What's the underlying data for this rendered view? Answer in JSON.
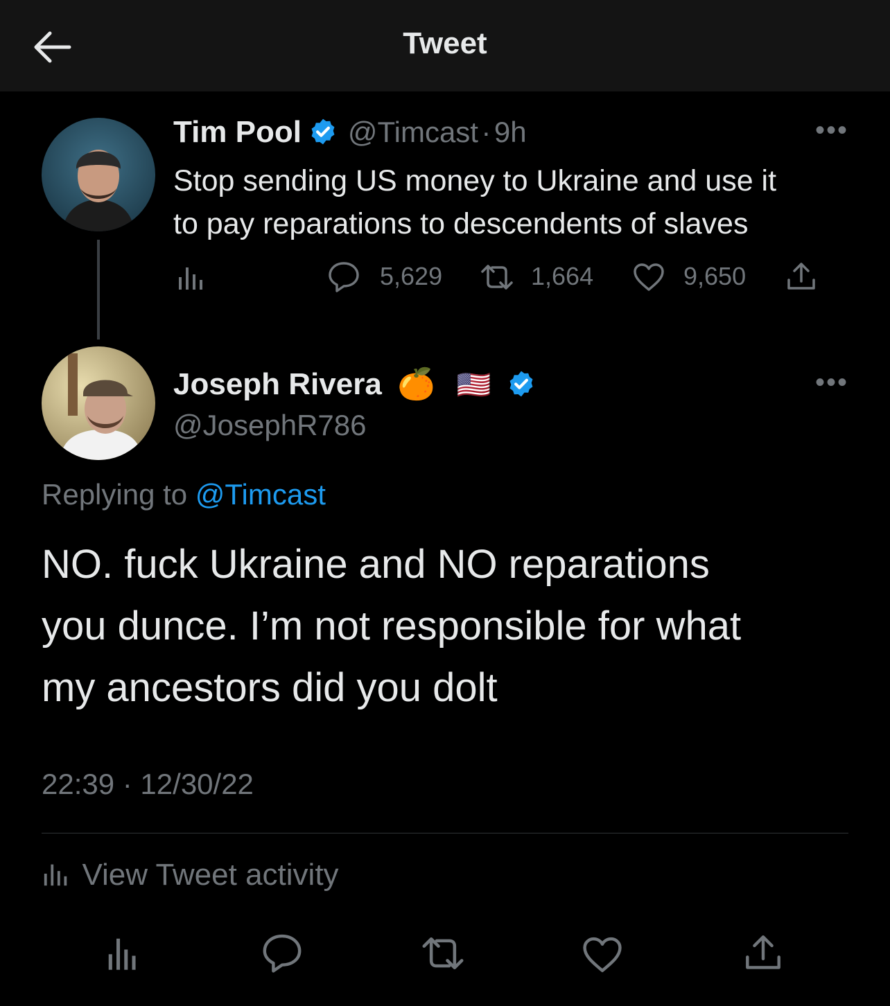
{
  "header": {
    "title": "Tweet",
    "back_icon": "arrow-left-icon"
  },
  "parent_tweet": {
    "display_name": "Tim Pool",
    "handle": "@Timcast",
    "separator": "·",
    "age": "9h",
    "text_line1": "Stop sending US money to Ukraine and use it",
    "text_line2": "to pay reparations to descendents of slaves",
    "stats": {
      "replies": "5,629",
      "retweets": "1,664",
      "likes": "9,650"
    }
  },
  "reply_tweet": {
    "display_name": "Joseph Rivera",
    "emoji_1": "🍊",
    "emoji_2": "🇺🇸",
    "handle": "@JosephR786",
    "replying_prefix": "Replying to",
    "replying_handle": "@Timcast",
    "text_line1": "NO. fuck Ukraine and NO reparations",
    "text_line2": "you dunce. I’m not responsible for what",
    "text_line3": "my ancestors did you dolt",
    "timestamp": "22:39 · 12/30/22"
  },
  "activity": {
    "label": "View Tweet activity"
  },
  "colors": {
    "background": "#000000",
    "header_bg": "#141414",
    "accent": "#1d9bf0",
    "muted": "#71767b",
    "text": "#e7e9ea"
  }
}
